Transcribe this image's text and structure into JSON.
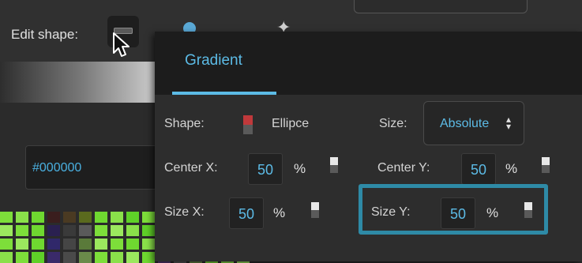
{
  "toolbar": {
    "edit_shape_label": "Edit shape:"
  },
  "color": {
    "hex_value": "#000000"
  },
  "popover": {
    "tab_label": "Gradient",
    "shape": {
      "label": "Shape:",
      "value": "Ellipce"
    },
    "size": {
      "label": "Size:",
      "value": "Absolute",
      "arrows": "▲▼"
    },
    "center_x": {
      "label": "Center X:",
      "value": "50",
      "unit": "%"
    },
    "center_y": {
      "label": "Center Y:",
      "value": "50",
      "unit": "%"
    },
    "size_x": {
      "label": "Size X:",
      "value": "50",
      "unit": "%"
    },
    "size_y": {
      "label": "Size Y:",
      "value": "50",
      "unit": "%"
    }
  },
  "colors": {
    "accent": "#5cbbe6",
    "highlight": "#2e8aa6",
    "shape_swatch": "#c0393b"
  },
  "icons": [
    "cursor-arrow-icon",
    "circle-tool-icon",
    "star-tool-icon",
    "toggle-icon",
    "shape-swatch-icon"
  ]
}
